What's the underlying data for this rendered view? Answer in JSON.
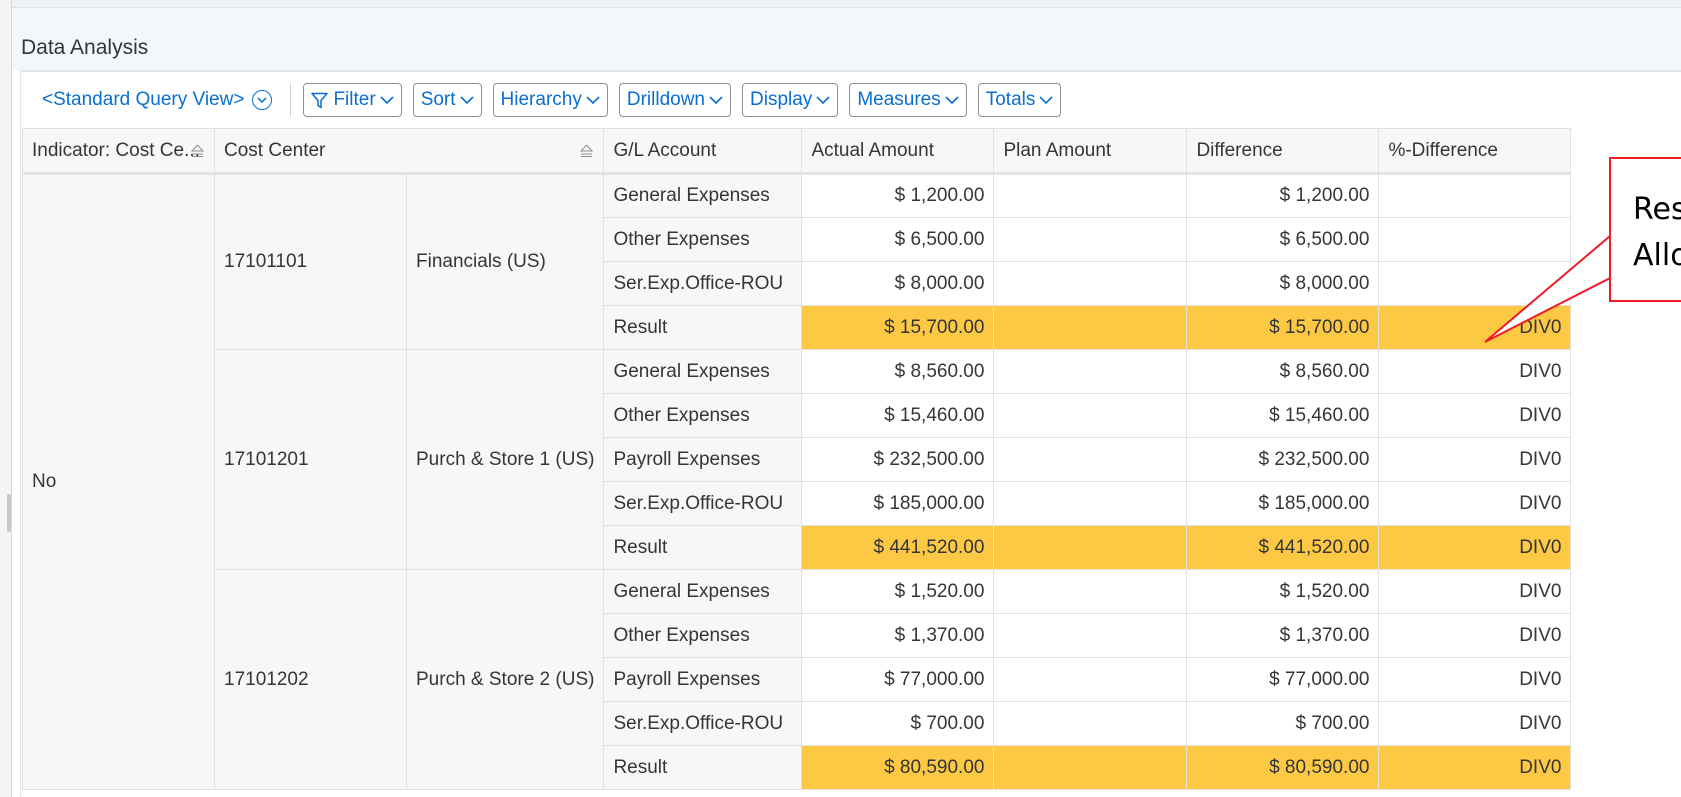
{
  "page": {
    "title": "Data Analysis"
  },
  "toolbar": {
    "view_label": "<Standard Query View>",
    "buttons": [
      {
        "label": "Filter",
        "icon": "filter-icon"
      },
      {
        "label": "Sort"
      },
      {
        "label": "Hierarchy"
      },
      {
        "label": "Drilldown"
      },
      {
        "label": "Display"
      },
      {
        "label": "Measures"
      },
      {
        "label": "Totals"
      }
    ]
  },
  "table": {
    "headers": {
      "indicator": "Indicator: Cost Ce...",
      "cost_center": "Cost Center",
      "gl_account": "G/L Account",
      "actual": "Actual Amount",
      "plan": "Plan Amount",
      "difference": "Difference",
      "pct_difference": "%-Difference"
    },
    "indicator_value": "No",
    "groups": [
      {
        "id": "17101101",
        "name": "Financials (US)",
        "rows": [
          {
            "gl": "General Expenses",
            "actual": "$ 1,200.00",
            "plan": "",
            "diff": "$ 1,200.00",
            "pct": ""
          },
          {
            "gl": "Other Expenses",
            "actual": "$ 6,500.00",
            "plan": "",
            "diff": "$ 6,500.00",
            "pct": ""
          },
          {
            "gl": "Ser.Exp.Office-ROU",
            "actual": "$ 8,000.00",
            "plan": "",
            "diff": "$ 8,000.00",
            "pct": ""
          },
          {
            "gl": "Result",
            "actual": "$ 15,700.00",
            "plan": "",
            "diff": "$ 15,700.00",
            "pct": "DIV0",
            "result": true
          }
        ]
      },
      {
        "id": "17101201",
        "name": "Purch & Store 1 (US)",
        "rows": [
          {
            "gl": "General Expenses",
            "actual": "$ 8,560.00",
            "plan": "",
            "diff": "$ 8,560.00",
            "pct": "DIV0"
          },
          {
            "gl": "Other Expenses",
            "actual": "$ 15,460.00",
            "plan": "",
            "diff": "$ 15,460.00",
            "pct": "DIV0"
          },
          {
            "gl": "Payroll Expenses",
            "actual": "$ 232,500.00",
            "plan": "",
            "diff": "$ 232,500.00",
            "pct": "DIV0"
          },
          {
            "gl": "Ser.Exp.Office-ROU",
            "actual": "$ 185,000.00",
            "plan": "",
            "diff": "$ 185,000.00",
            "pct": "DIV0"
          },
          {
            "gl": "Result",
            "actual": "$ 441,520.00",
            "plan": "",
            "diff": "$ 441,520.00",
            "pct": "DIV0",
            "result": true
          }
        ]
      },
      {
        "id": "17101202",
        "name": "Purch & Store 2 (US)",
        "rows": [
          {
            "gl": "General Expenses",
            "actual": "$ 1,520.00",
            "plan": "",
            "diff": "$ 1,520.00",
            "pct": "DIV0"
          },
          {
            "gl": "Other Expenses",
            "actual": "$ 1,370.00",
            "plan": "",
            "diff": "$ 1,370.00",
            "pct": "DIV0"
          },
          {
            "gl": "Payroll Expenses",
            "actual": "$ 77,000.00",
            "plan": "",
            "diff": "$ 77,000.00",
            "pct": "DIV0"
          },
          {
            "gl": "Ser.Exp.Office-ROU",
            "actual": "$ 700.00",
            "plan": "",
            "diff": "$ 700.00",
            "pct": "DIV0"
          },
          {
            "gl": "Result",
            "actual": "$ 80,590.00",
            "plan": "",
            "diff": "$ 80,590.00",
            "pct": "DIV0",
            "result": true
          }
        ]
      }
    ]
  },
  "callout": {
    "line1": "Res",
    "line2": "Allo"
  },
  "colors": {
    "accent": "#0a6ed1",
    "result_highlight": "#fdc844",
    "callout_border": "#ee1c25"
  }
}
